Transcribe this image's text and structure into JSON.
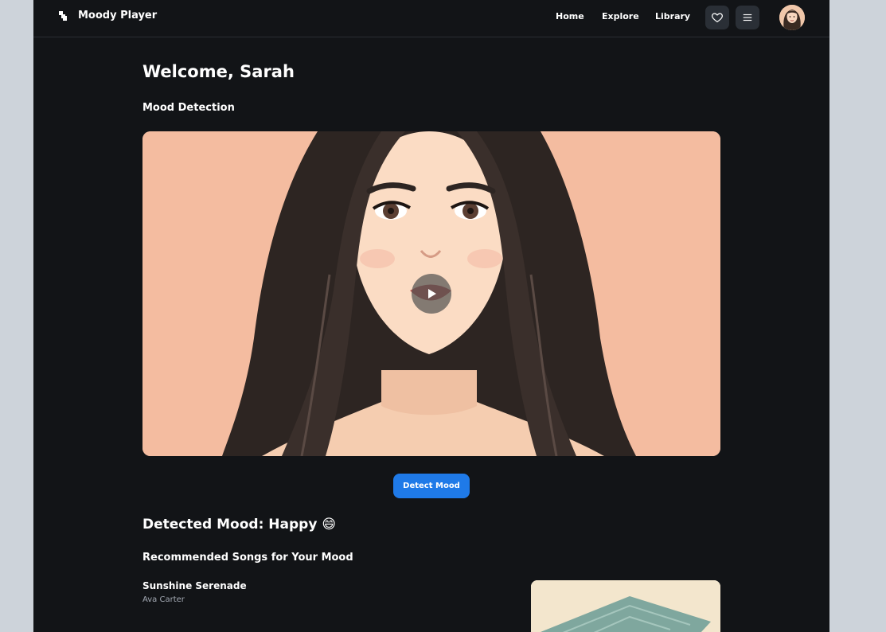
{
  "header": {
    "app_name": "Moody Player",
    "nav": [
      "Home",
      "Explore",
      "Library"
    ],
    "icons": [
      "heart-icon",
      "menu-icon"
    ]
  },
  "main": {
    "welcome": "Welcome, Sarah",
    "mood_detection_title": "Mood Detection",
    "detect_button": "Detect Mood",
    "detected_mood": "Detected Mood: Happy 😄",
    "recommended_title": "Recommended Songs for Your Mood",
    "songs": [
      {
        "title": "Sunshine Serenade",
        "artist": "Ava Carter"
      }
    ]
  },
  "colors": {
    "background": "#121417",
    "accent": "#1f7ae8",
    "video_bg": "#f4bca0"
  }
}
